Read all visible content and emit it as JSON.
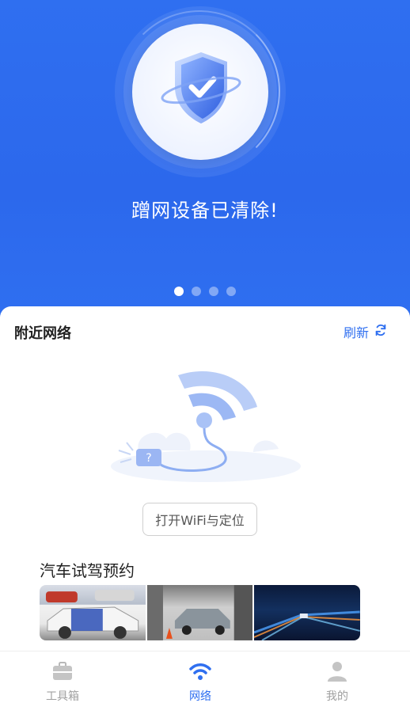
{
  "hero": {
    "title": "蹭网设备已清除!",
    "carousel_count": 4,
    "carousel_active": 1
  },
  "nearby": {
    "title": "附近网络",
    "refresh_label": "刷新",
    "open_button_label": "打开WiFi与定位"
  },
  "promo": {
    "title": "汽车试驾预约"
  },
  "tabs": [
    {
      "label": "工具箱",
      "icon": "toolbox-icon",
      "active": false
    },
    {
      "label": "网络",
      "icon": "wifi-icon",
      "active": true
    },
    {
      "label": "我的",
      "icon": "user-icon",
      "active": false
    }
  ],
  "colors": {
    "primary": "#2f6ff0",
    "inactive": "#a0a0a0"
  }
}
